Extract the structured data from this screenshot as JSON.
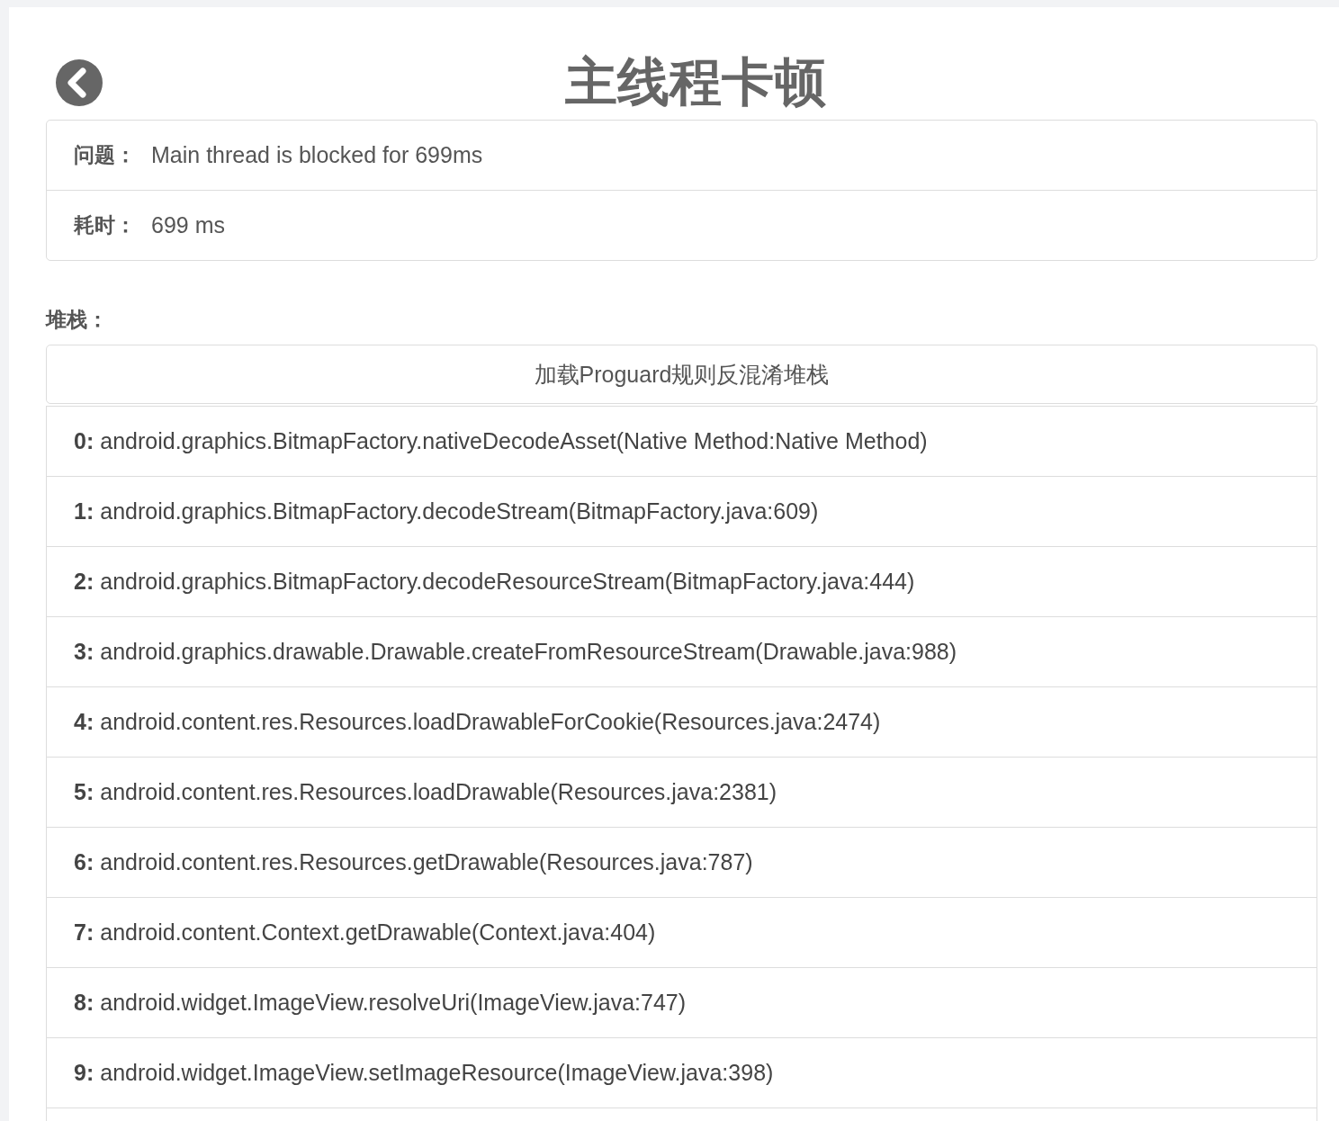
{
  "header": {
    "title": "主线程卡顿"
  },
  "info": [
    {
      "label": "问题：",
      "value": "Main thread is blocked for 699ms"
    },
    {
      "label": "耗时：",
      "value": "699 ms"
    }
  ],
  "stack": {
    "label": "堆栈：",
    "button": "加载Proguard规则反混淆堆栈",
    "frames": [
      {
        "index": "0:",
        "text": "android.graphics.BitmapFactory.nativeDecodeAsset(Native Method:Native Method)"
      },
      {
        "index": "1:",
        "text": "android.graphics.BitmapFactory.decodeStream(BitmapFactory.java:609)"
      },
      {
        "index": "2:",
        "text": "android.graphics.BitmapFactory.decodeResourceStream(BitmapFactory.java:444)"
      },
      {
        "index": "3:",
        "text": "android.graphics.drawable.Drawable.createFromResourceStream(Drawable.java:988)"
      },
      {
        "index": "4:",
        "text": "android.content.res.Resources.loadDrawableForCookie(Resources.java:2474)"
      },
      {
        "index": "5:",
        "text": "android.content.res.Resources.loadDrawable(Resources.java:2381)"
      },
      {
        "index": "6:",
        "text": "android.content.res.Resources.getDrawable(Resources.java:787)"
      },
      {
        "index": "7:",
        "text": "android.content.Context.getDrawable(Context.java:404)"
      },
      {
        "index": "8:",
        "text": "android.widget.ImageView.resolveUri(ImageView.java:747)"
      },
      {
        "index": "9:",
        "text": "android.widget.ImageView.setImageResource(ImageView.java:398)"
      }
    ]
  }
}
